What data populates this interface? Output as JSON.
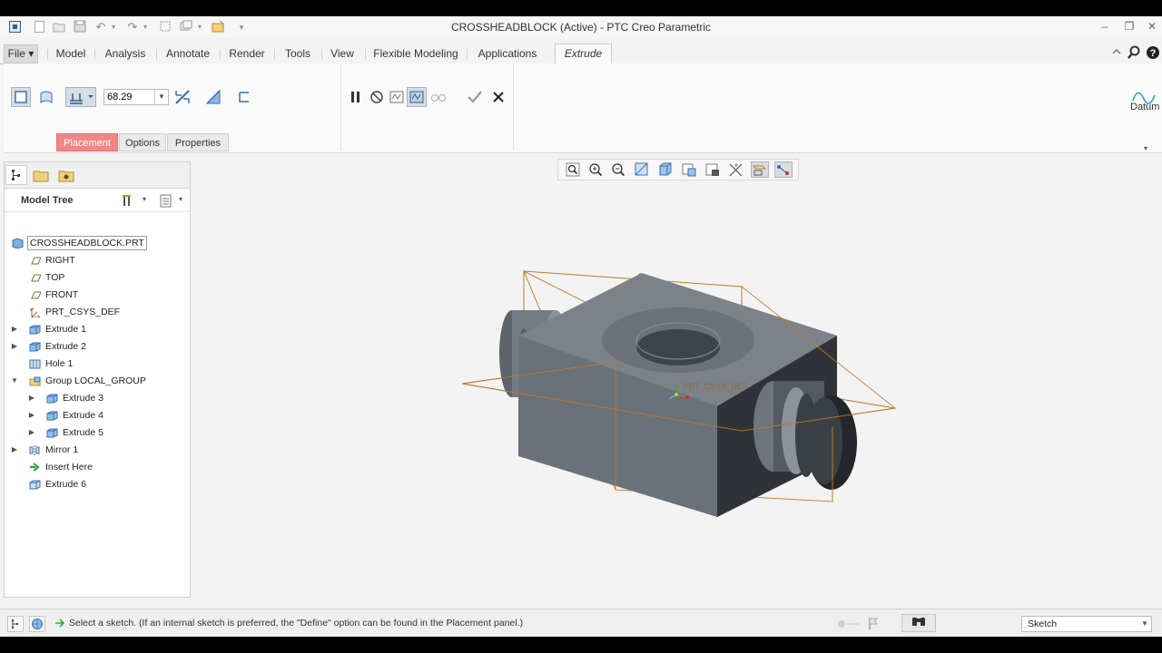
{
  "window": {
    "title": "CROSSHEADBLOCK (Active) - PTC Creo Parametric",
    "controls": [
      "minimize-icon",
      "restore-icon",
      "close-icon"
    ]
  },
  "quick_access": [
    "new-icon",
    "open-icon",
    "save-icon",
    "undo-icon",
    "redo-icon",
    "regenerate-icon",
    "windows-icon",
    "close-window-icon",
    "customize-icon"
  ],
  "ribbon_tabs": [
    {
      "label": "File ▾"
    },
    {
      "label": "Model"
    },
    {
      "label": "Analysis"
    },
    {
      "label": "Annotate"
    },
    {
      "label": "Render"
    },
    {
      "label": "Tools"
    },
    {
      "label": "View"
    },
    {
      "label": "Flexible Modeling"
    },
    {
      "label": "Applications"
    },
    {
      "label": "Extrude"
    }
  ],
  "extrude": {
    "depth_value": "68.29",
    "buttons": [
      "solid-icon",
      "surface-icon",
      "depth-blind-icon",
      "flip-direction-icon",
      "remove-material-icon",
      "thicken-icon",
      "pause-icon",
      "no-preview-icon",
      "verify-icon",
      "preview-icon",
      "glasses-icon",
      "ok-check-icon",
      "cancel-x-icon"
    ],
    "subtabs": [
      "Placement",
      "Options",
      "Properties"
    ]
  },
  "datum": {
    "label": "Datum"
  },
  "model_tree": {
    "title": "Model Tree",
    "root": "CROSSHEADBLOCK.PRT",
    "items": [
      {
        "label": "RIGHT",
        "icon": "datum-plane-icon",
        "level": 0,
        "expandable": false
      },
      {
        "label": "TOP",
        "icon": "datum-plane-icon",
        "level": 0,
        "expandable": false
      },
      {
        "label": "FRONT",
        "icon": "datum-plane-icon",
        "level": 0,
        "expandable": false
      },
      {
        "label": "PRT_CSYS_DEF",
        "icon": "csys-icon",
        "level": 0,
        "expandable": false
      },
      {
        "label": "Extrude 1",
        "icon": "extrude-icon",
        "level": 0,
        "expandable": true
      },
      {
        "label": "Extrude 2",
        "icon": "extrude-icon",
        "level": 0,
        "expandable": true
      },
      {
        "label": "Hole 1",
        "icon": "hole-icon",
        "level": 0,
        "expandable": false
      },
      {
        "label": "Group LOCAL_GROUP",
        "icon": "group-icon",
        "level": 0,
        "expandable": true,
        "expanded": true
      },
      {
        "label": "Extrude 3",
        "icon": "extrude-icon",
        "level": 1,
        "expandable": true
      },
      {
        "label": "Extrude 4",
        "icon": "extrude-icon",
        "level": 1,
        "expandable": true
      },
      {
        "label": "Extrude 5",
        "icon": "extrude-icon",
        "level": 1,
        "expandable": true
      },
      {
        "label": "Mirror 1",
        "icon": "mirror-icon",
        "level": 0,
        "expandable": true
      },
      {
        "label": "Insert Here",
        "icon": "insert-arrow-icon",
        "level": 0,
        "expandable": false
      },
      {
        "label": "Extrude 6",
        "icon": "extrude-new-icon",
        "level": 0,
        "expandable": false
      }
    ]
  },
  "view_toolbar": [
    "refit-icon",
    "zoom-in-icon",
    "zoom-out-icon",
    "repaint-icon",
    "display-style-icon",
    "saved-views-icon",
    "view-manager-icon",
    "perspective-icon",
    "datum-display-icon",
    "annotation-display-icon"
  ],
  "graphics": {
    "csys_label": "PRT_CSYS_DEF"
  },
  "status": {
    "message": "Select a sketch. (If an internal sketch is preferred, the \"Define\" option can be found in the Placement panel.)",
    "filter_value": "Sketch"
  },
  "colors": {
    "placement_tab": "#f08787",
    "datum_plane": "#c07a2a",
    "model_body": "#6f757c",
    "csys_green": "#3aaa3a",
    "csys_cyan": "#3ac6d6"
  }
}
